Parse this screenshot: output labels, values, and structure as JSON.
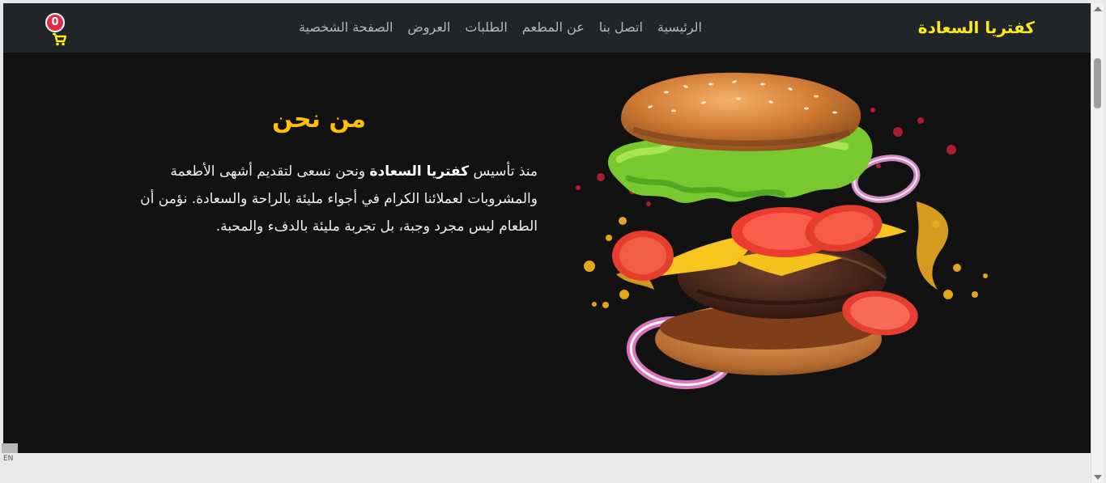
{
  "brand": "كفتريا السعادة",
  "nav": [
    "الرئيسية",
    "اتصل بنا",
    "عن المطعم",
    "الطلبات",
    "العروض",
    "الصفحة الشخصية"
  ],
  "cart": {
    "count": "0",
    "icon": "cart-icon"
  },
  "about": {
    "title": "من نحن",
    "text_prefix": "منذ تأسيس ",
    "text_highlight": "كفتريا السعادة",
    "text_rest": " ونحن نسعى لتقديم أشهى الأطعمة والمشروبات لعملائنا الكرام في أجواء مليئة بالراحة والسعادة. نؤمن أن الطعام ليس مجرد وجبة، بل تجربة مليئة بالدفء والمحبة."
  },
  "footer": {
    "language": "EN"
  },
  "colors": {
    "brand": "#ffe819",
    "accent": "#ffc107",
    "nav_bg": "#212529",
    "page_bg": "#121212",
    "badge": "#e02f45"
  }
}
